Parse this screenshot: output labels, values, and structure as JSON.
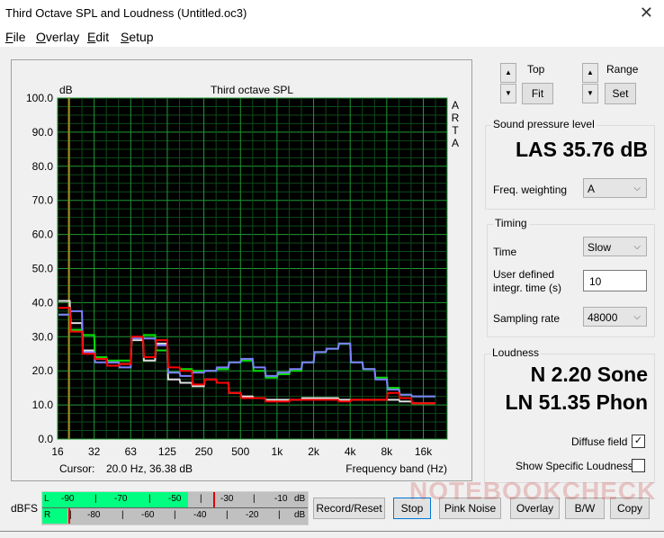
{
  "window": {
    "title": "Third Octave SPL and Loudness (Untitled.oc3)",
    "close_icon": "close-icon"
  },
  "menu": [
    {
      "label": "File",
      "accel": "F",
      "rest": "ile"
    },
    {
      "label": "Overlay",
      "accel": "O",
      "rest": "verlay"
    },
    {
      "label": "Edit",
      "accel": "E",
      "rest": "dit"
    },
    {
      "label": "Setup",
      "accel": "S",
      "rest": "etup"
    }
  ],
  "chart_data": {
    "type": "line",
    "title": "Third octave SPL",
    "ylabel": "dB",
    "xlabel": "Frequency band (Hz)",
    "ylim": [
      0,
      100
    ],
    "yticks": [
      "0.0",
      "10.0",
      "20.0",
      "30.0",
      "40.0",
      "50.0",
      "60.0",
      "70.0",
      "80.0",
      "90.0",
      "100.0"
    ],
    "xticks": [
      "16",
      "32",
      "63",
      "125",
      "250",
      "500",
      "1k",
      "2k",
      "4k",
      "8k",
      "16k"
    ],
    "side_label": [
      "A",
      "R",
      "T",
      "A"
    ],
    "grid": true,
    "cursor_band_index": 1,
    "bands": [
      "16",
      "20",
      "25",
      "31.5",
      "40",
      "50",
      "63",
      "80",
      "100",
      "125",
      "160",
      "200",
      "250",
      "315",
      "400",
      "500",
      "630",
      "800",
      "1k",
      "1.25k",
      "1.6k",
      "2k",
      "2.5k",
      "3.15k",
      "4k",
      "5k",
      "6.3k",
      "8k",
      "10k",
      "12.5k",
      "16k"
    ],
    "series": [
      {
        "name": "white",
        "color": "#e0e0e0",
        "values": [
          40.5,
          34,
          26,
          23.5,
          22.5,
          22,
          29,
          23,
          28,
          17.5,
          16.5,
          15.5,
          17.5,
          16.5,
          13.5,
          12.5,
          12,
          11.5,
          11.5,
          11.5,
          12,
          12,
          12,
          11.5,
          11.5,
          11.5,
          11.5,
          11.5,
          11,
          10.5,
          10.5
        ]
      },
      {
        "name": "green",
        "color": "#00e000",
        "values": [
          36.5,
          32,
          30.5,
          24,
          23,
          23,
          29.5,
          30.5,
          26,
          19.5,
          20.5,
          20,
          20,
          20.5,
          22.5,
          23,
          20,
          18,
          19,
          20,
          22.5,
          25.5,
          26.5,
          28,
          22.5,
          20.5,
          18,
          15,
          13,
          12.5,
          12.5
        ]
      },
      {
        "name": "blue",
        "color": "#8080ff",
        "values": [
          36.5,
          37.5,
          25.5,
          22.5,
          22.5,
          21,
          29.5,
          29.5,
          27.5,
          19.5,
          18.5,
          19.5,
          20,
          21,
          22.5,
          23.5,
          21,
          18.5,
          19.5,
          20.5,
          22.5,
          25.5,
          26.5,
          28,
          22.5,
          20.5,
          17.5,
          14.5,
          13,
          12.5,
          12.5
        ]
      },
      {
        "name": "red",
        "color": "#ff0000",
        "values": [
          38.5,
          31.5,
          25,
          23.5,
          21.5,
          22,
          30,
          24,
          29,
          21,
          20,
          16,
          17.5,
          16.5,
          13.5,
          12,
          12,
          11,
          11,
          11.5,
          11.5,
          11.5,
          11.5,
          11,
          11.5,
          11.5,
          11.5,
          13.5,
          12,
          10.5,
          10.5
        ]
      }
    ]
  },
  "cursor_readout": {
    "label": "Cursor:",
    "value": "20.0 Hz, 36.38 dB"
  },
  "controls": {
    "top_label": "Top",
    "fit_label": "Fit",
    "range_label": "Range",
    "set_label": "Set",
    "up_icon": "▲",
    "down_icon": "▼"
  },
  "spl": {
    "group_title": "Sound pressure level",
    "value": "LAS 35.76 dB",
    "weighting_label": "Freq. weighting",
    "weighting_value": "A"
  },
  "timing": {
    "group_title": "Timing",
    "time_label": "Time",
    "time_value": "Slow",
    "integr_label_1": "User defined",
    "integr_label_2": "integr. time (s)",
    "integr_value": "10",
    "sampling_label": "Sampling rate",
    "sampling_value": "48000"
  },
  "loudness": {
    "group_title": "Loudness",
    "n_value": "N 2.20 Sone",
    "ln_value": "LN 51.35 Phon",
    "diffuse_label": "Diffuse field",
    "diffuse_checked": true,
    "specific_label": "Show Specific Loudness",
    "specific_checked": false
  },
  "meter": {
    "label": "dBFS",
    "left_channel": "L",
    "right_channel": "R",
    "unit": "dB",
    "top_ticks": [
      "-90",
      "|",
      "-70",
      "|",
      "-50",
      "|",
      "-30",
      "|",
      "-10"
    ],
    "bottom_ticks": [
      "|",
      "-80",
      "|",
      "-60",
      "|",
      "-40",
      "|",
      "-20",
      "|"
    ],
    "left_level_fraction": 0.55,
    "left_peak_fraction": 0.645,
    "right_level_fraction": 0.095,
    "right_peak_fraction": 0.097,
    "fill_color": "#00ff80",
    "peak_color": "#e00000"
  },
  "buttons": [
    "Record/Reset",
    "Stop",
    "Pink Noise",
    "Overlay",
    "B/W",
    "Copy"
  ],
  "watermark": "NOTEBOOKCHECK"
}
